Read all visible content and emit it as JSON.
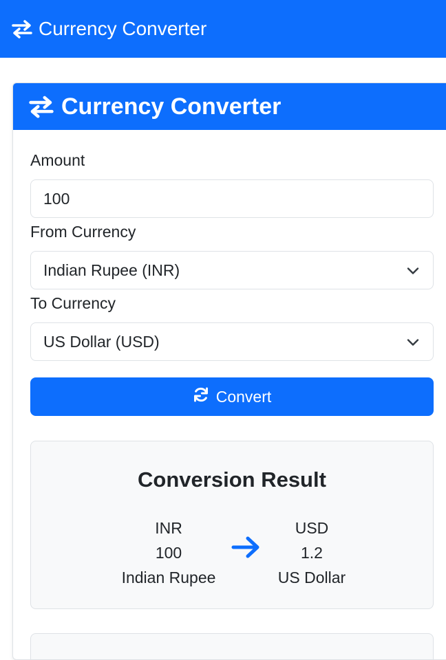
{
  "navbar": {
    "icon": "exchange-arrows-icon",
    "brand": "Currency Converter"
  },
  "card": {
    "header_icon": "exchange-arrows-icon",
    "header_title": "Currency Converter"
  },
  "form": {
    "amount_label": "Amount",
    "amount_value": "100",
    "from_label": "From Currency",
    "from_selected": "Indian Rupee (INR)",
    "to_label": "To Currency",
    "to_selected": "US Dollar (USD)",
    "convert_icon": "refresh-icon",
    "convert_label": "Convert"
  },
  "result": {
    "title": "Conversion Result",
    "from": {
      "code": "INR",
      "amount": "100",
      "name": "Indian Rupee"
    },
    "arrow_icon": "arrow-right-icon",
    "to": {
      "code": "USD",
      "amount": "1.2",
      "name": "US Dollar"
    }
  },
  "colors": {
    "primary": "#0d6efd",
    "panel": "#f8f9fa",
    "border": "#dee2e6",
    "text": "#212529"
  }
}
